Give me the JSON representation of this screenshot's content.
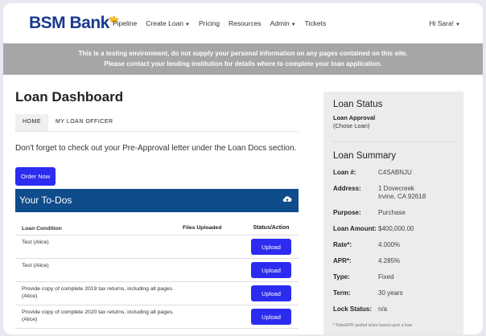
{
  "brand": {
    "name": "BSM Bank",
    "logo_color": "#1a3a8e",
    "accent": "#f3b619"
  },
  "nav": {
    "items": [
      {
        "label": "Pipeline",
        "dropdown": false
      },
      {
        "label": "Create Loan",
        "dropdown": true
      },
      {
        "label": "Pricing",
        "dropdown": false
      },
      {
        "label": "Resources",
        "dropdown": false
      },
      {
        "label": "Admin",
        "dropdown": true
      },
      {
        "label": "Tickets",
        "dropdown": false
      }
    ],
    "user_greeting": "Hi Sara!"
  },
  "banner": {
    "line1": "This is a testing environment, do not supply your personal information on any pages contained on this site.",
    "line2": "Please contact your lending institution for details where to complete your loan application."
  },
  "page": {
    "title": "Loan Dashboard",
    "tabs": [
      {
        "label": "HOME",
        "active": true
      },
      {
        "label": "MY LOAN OFFICER",
        "active": false
      }
    ],
    "note": "Don't forget to check out your Pre-Approval letter under the Loan Docs section.",
    "order_button": "Order Now"
  },
  "todos": {
    "title": "Your To-Dos",
    "columns": {
      "condition": "Loan Condition",
      "files": "Files Uploaded",
      "status": "Status/Action"
    },
    "rows": [
      {
        "condition": "Test (Alice)",
        "files": "",
        "action": "Upload"
      },
      {
        "condition": "Test (Alice)",
        "files": "",
        "action": "Upload"
      },
      {
        "condition": "Provide copy of complete 2019 tax returns, including all pages. (Alice)",
        "files": "",
        "action": "Upload"
      },
      {
        "condition": "Provide copy of complete 2020 tax returns, including all pages. (Alice)",
        "files": "",
        "action": "Upload"
      }
    ]
  },
  "status": {
    "title": "Loan Status",
    "approval": "Loan Approval",
    "detail": "(Chose Loan)"
  },
  "summary": {
    "title": "Loan Summary",
    "fields": [
      {
        "key": "Loan #:",
        "value": "C4SABNJU"
      },
      {
        "key": "Address:",
        "value": "1 Dovecreek",
        "value2": "Irvine, CA 92618"
      },
      {
        "key": "Purpose:",
        "value": "Purchase"
      },
      {
        "key": "Loan Amount:",
        "value": "$400,000.00"
      },
      {
        "key": "Rate*:",
        "value": "4.000%"
      },
      {
        "key": "APR*:",
        "value": "4.285%"
      },
      {
        "key": "Type:",
        "value": "Fixed"
      },
      {
        "key": "Term:",
        "value": "30 years"
      },
      {
        "key": "Lock Status:",
        "value": "n/a"
      }
    ],
    "footnote": "* Rate/APR quoted is/are based upon a loan"
  }
}
